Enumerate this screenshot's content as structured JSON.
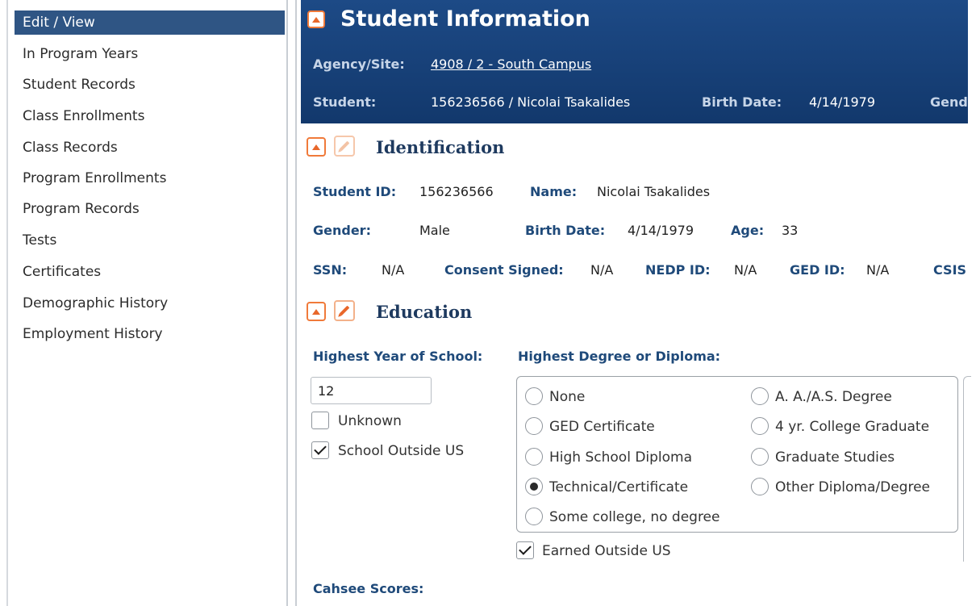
{
  "sidebar": {
    "items": [
      {
        "label": "Edit / View",
        "active": true
      },
      {
        "label": "In Program Years"
      },
      {
        "label": "Student Records"
      },
      {
        "label": "Class Enrollments"
      },
      {
        "label": "Class Records"
      },
      {
        "label": "Program Enrollments"
      },
      {
        "label": "Program Records"
      },
      {
        "label": "Tests"
      },
      {
        "label": "Certificates"
      },
      {
        "label": "Demographic History"
      },
      {
        "label": "Employment History"
      }
    ]
  },
  "header": {
    "title": "Student Information",
    "agency_label": "Agency/Site:",
    "agency_value": "4908 / 2 - South Campus",
    "student_label": "Student:",
    "student_value": "156236566 / Nicolai Tsakalides",
    "birth_label": "Birth Date:",
    "birth_value": "4/14/1979",
    "gender_label_partial": "Gender"
  },
  "identification": {
    "title": "Identification",
    "student_id_label": "Student ID:",
    "student_id_value": "156236566",
    "name_label": "Name:",
    "name_value": "Nicolai Tsakalides",
    "gender_label": "Gender:",
    "gender_value": "Male",
    "birth_label": "Birth Date:",
    "birth_value": "4/14/1979",
    "age_label": "Age:",
    "age_value": "33",
    "ssn_label": "SSN:",
    "ssn_value": "N/A",
    "consent_label": "Consent Signed:",
    "consent_value": "N/A",
    "nedp_label": "NEDP ID:",
    "nedp_value": "N/A",
    "ged_label": "GED ID:",
    "ged_value": "N/A",
    "csis_label_partial": "CSIS"
  },
  "education": {
    "title": "Education",
    "highest_year_label": "Highest Year of School:",
    "highest_year_value": "12",
    "unknown_label": "Unknown",
    "unknown_checked": false,
    "outside_us_label": "School Outside US",
    "outside_us_checked": true,
    "degree_label": "Highest Degree or Diploma:",
    "degree_options_left": [
      "None",
      "GED Certificate",
      "High School Diploma",
      "Technical/Certificate",
      "Some college, no degree"
    ],
    "degree_options_right": [
      "A. A./A.S. Degree",
      "4 yr. College Graduate",
      "Graduate Studies",
      "Other Diploma/Degree"
    ],
    "selected_degree": "Technical/Certificate",
    "earned_outside_label": "Earned Outside US",
    "earned_outside_checked": true,
    "cahsee_label": "Cahsee Scores:"
  },
  "colors": {
    "header_bg": "#1d4a86",
    "sidebar_active_bg": "#2f5584",
    "accent_orange": "#e8672a",
    "label_blue": "#1f4a7a"
  }
}
